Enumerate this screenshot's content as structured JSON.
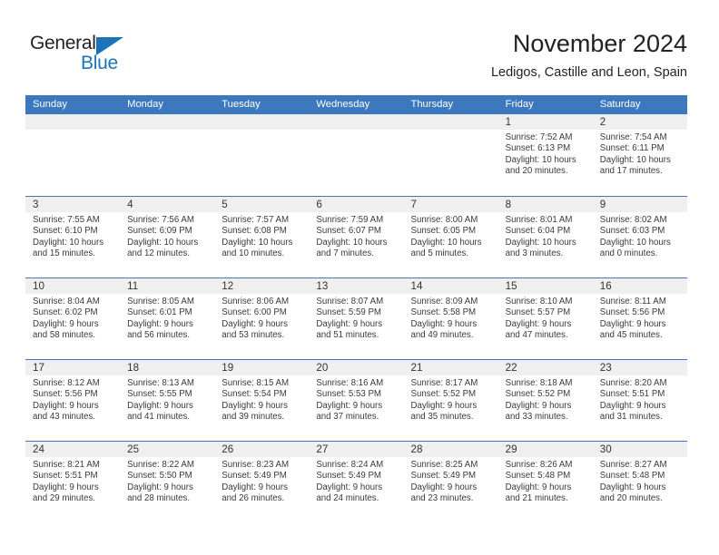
{
  "logo": {
    "word_top": "General",
    "word_bottom": "Blue",
    "triangle_color": "#1b73ba"
  },
  "header": {
    "title": "November 2024",
    "subtitle": "Ledigos, Castille and Leon, Spain"
  },
  "colors": {
    "header_blue": "#3b78bd",
    "day_strip_gray": "#efefef",
    "text": "#3a3a3a"
  },
  "calendar": {
    "day_headers": [
      "Sunday",
      "Monday",
      "Tuesday",
      "Wednesday",
      "Thursday",
      "Friday",
      "Saturday"
    ],
    "weeks": [
      [
        {
          "day": "",
          "empty": true
        },
        {
          "day": "",
          "empty": true
        },
        {
          "day": "",
          "empty": true
        },
        {
          "day": "",
          "empty": true
        },
        {
          "day": "",
          "empty": true
        },
        {
          "day": "1",
          "sunrise": "Sunrise: 7:52 AM",
          "sunset": "Sunset: 6:13 PM",
          "daylight1": "Daylight: 10 hours",
          "daylight2": "and 20 minutes."
        },
        {
          "day": "2",
          "sunrise": "Sunrise: 7:54 AM",
          "sunset": "Sunset: 6:11 PM",
          "daylight1": "Daylight: 10 hours",
          "daylight2": "and 17 minutes."
        }
      ],
      [
        {
          "day": "3",
          "sunrise": "Sunrise: 7:55 AM",
          "sunset": "Sunset: 6:10 PM",
          "daylight1": "Daylight: 10 hours",
          "daylight2": "and 15 minutes."
        },
        {
          "day": "4",
          "sunrise": "Sunrise: 7:56 AM",
          "sunset": "Sunset: 6:09 PM",
          "daylight1": "Daylight: 10 hours",
          "daylight2": "and 12 minutes."
        },
        {
          "day": "5",
          "sunrise": "Sunrise: 7:57 AM",
          "sunset": "Sunset: 6:08 PM",
          "daylight1": "Daylight: 10 hours",
          "daylight2": "and 10 minutes."
        },
        {
          "day": "6",
          "sunrise": "Sunrise: 7:59 AM",
          "sunset": "Sunset: 6:07 PM",
          "daylight1": "Daylight: 10 hours",
          "daylight2": "and 7 minutes."
        },
        {
          "day": "7",
          "sunrise": "Sunrise: 8:00 AM",
          "sunset": "Sunset: 6:05 PM",
          "daylight1": "Daylight: 10 hours",
          "daylight2": "and 5 minutes."
        },
        {
          "day": "8",
          "sunrise": "Sunrise: 8:01 AM",
          "sunset": "Sunset: 6:04 PM",
          "daylight1": "Daylight: 10 hours",
          "daylight2": "and 3 minutes."
        },
        {
          "day": "9",
          "sunrise": "Sunrise: 8:02 AM",
          "sunset": "Sunset: 6:03 PM",
          "daylight1": "Daylight: 10 hours",
          "daylight2": "and 0 minutes."
        }
      ],
      [
        {
          "day": "10",
          "sunrise": "Sunrise: 8:04 AM",
          "sunset": "Sunset: 6:02 PM",
          "daylight1": "Daylight: 9 hours",
          "daylight2": "and 58 minutes."
        },
        {
          "day": "11",
          "sunrise": "Sunrise: 8:05 AM",
          "sunset": "Sunset: 6:01 PM",
          "daylight1": "Daylight: 9 hours",
          "daylight2": "and 56 minutes."
        },
        {
          "day": "12",
          "sunrise": "Sunrise: 8:06 AM",
          "sunset": "Sunset: 6:00 PM",
          "daylight1": "Daylight: 9 hours",
          "daylight2": "and 53 minutes."
        },
        {
          "day": "13",
          "sunrise": "Sunrise: 8:07 AM",
          "sunset": "Sunset: 5:59 PM",
          "daylight1": "Daylight: 9 hours",
          "daylight2": "and 51 minutes."
        },
        {
          "day": "14",
          "sunrise": "Sunrise: 8:09 AM",
          "sunset": "Sunset: 5:58 PM",
          "daylight1": "Daylight: 9 hours",
          "daylight2": "and 49 minutes."
        },
        {
          "day": "15",
          "sunrise": "Sunrise: 8:10 AM",
          "sunset": "Sunset: 5:57 PM",
          "daylight1": "Daylight: 9 hours",
          "daylight2": "and 47 minutes."
        },
        {
          "day": "16",
          "sunrise": "Sunrise: 8:11 AM",
          "sunset": "Sunset: 5:56 PM",
          "daylight1": "Daylight: 9 hours",
          "daylight2": "and 45 minutes."
        }
      ],
      [
        {
          "day": "17",
          "sunrise": "Sunrise: 8:12 AM",
          "sunset": "Sunset: 5:56 PM",
          "daylight1": "Daylight: 9 hours",
          "daylight2": "and 43 minutes."
        },
        {
          "day": "18",
          "sunrise": "Sunrise: 8:13 AM",
          "sunset": "Sunset: 5:55 PM",
          "daylight1": "Daylight: 9 hours",
          "daylight2": "and 41 minutes."
        },
        {
          "day": "19",
          "sunrise": "Sunrise: 8:15 AM",
          "sunset": "Sunset: 5:54 PM",
          "daylight1": "Daylight: 9 hours",
          "daylight2": "and 39 minutes."
        },
        {
          "day": "20",
          "sunrise": "Sunrise: 8:16 AM",
          "sunset": "Sunset: 5:53 PM",
          "daylight1": "Daylight: 9 hours",
          "daylight2": "and 37 minutes."
        },
        {
          "day": "21",
          "sunrise": "Sunrise: 8:17 AM",
          "sunset": "Sunset: 5:52 PM",
          "daylight1": "Daylight: 9 hours",
          "daylight2": "and 35 minutes."
        },
        {
          "day": "22",
          "sunrise": "Sunrise: 8:18 AM",
          "sunset": "Sunset: 5:52 PM",
          "daylight1": "Daylight: 9 hours",
          "daylight2": "and 33 minutes."
        },
        {
          "day": "23",
          "sunrise": "Sunrise: 8:20 AM",
          "sunset": "Sunset: 5:51 PM",
          "daylight1": "Daylight: 9 hours",
          "daylight2": "and 31 minutes."
        }
      ],
      [
        {
          "day": "24",
          "sunrise": "Sunrise: 8:21 AM",
          "sunset": "Sunset: 5:51 PM",
          "daylight1": "Daylight: 9 hours",
          "daylight2": "and 29 minutes."
        },
        {
          "day": "25",
          "sunrise": "Sunrise: 8:22 AM",
          "sunset": "Sunset: 5:50 PM",
          "daylight1": "Daylight: 9 hours",
          "daylight2": "and 28 minutes."
        },
        {
          "day": "26",
          "sunrise": "Sunrise: 8:23 AM",
          "sunset": "Sunset: 5:49 PM",
          "daylight1": "Daylight: 9 hours",
          "daylight2": "and 26 minutes."
        },
        {
          "day": "27",
          "sunrise": "Sunrise: 8:24 AM",
          "sunset": "Sunset: 5:49 PM",
          "daylight1": "Daylight: 9 hours",
          "daylight2": "and 24 minutes."
        },
        {
          "day": "28",
          "sunrise": "Sunrise: 8:25 AM",
          "sunset": "Sunset: 5:49 PM",
          "daylight1": "Daylight: 9 hours",
          "daylight2": "and 23 minutes."
        },
        {
          "day": "29",
          "sunrise": "Sunrise: 8:26 AM",
          "sunset": "Sunset: 5:48 PM",
          "daylight1": "Daylight: 9 hours",
          "daylight2": "and 21 minutes."
        },
        {
          "day": "30",
          "sunrise": "Sunrise: 8:27 AM",
          "sunset": "Sunset: 5:48 PM",
          "daylight1": "Daylight: 9 hours",
          "daylight2": "and 20 minutes."
        }
      ]
    ]
  }
}
